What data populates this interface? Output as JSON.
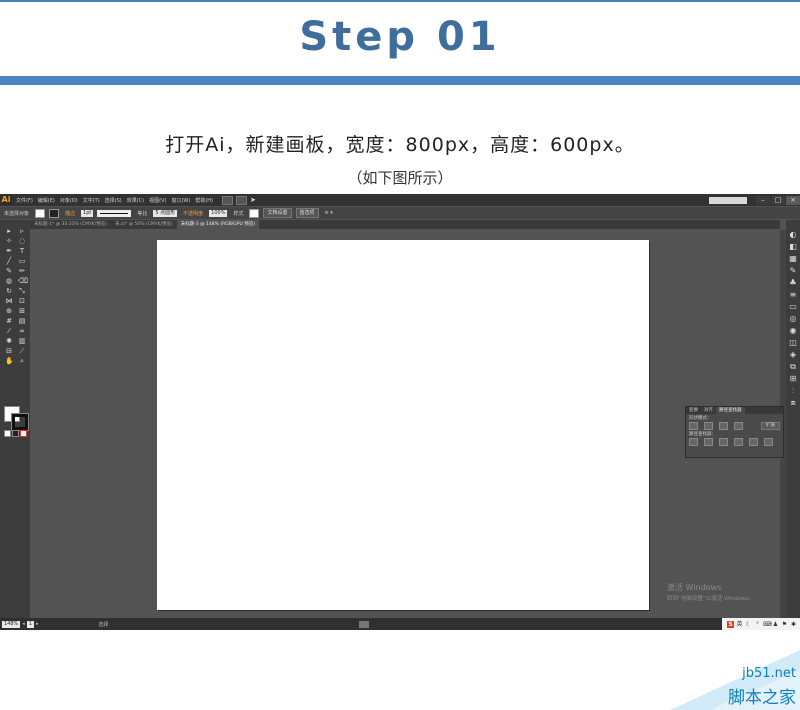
{
  "header": {
    "step_title": "Step 01",
    "instruction": "打开Ai，新建画板，宽度：800px，高度：600px。",
    "subnote": "（如下图所示）"
  },
  "app": {
    "logo": "Ai",
    "menu": [
      "文件(F)",
      "编辑(E)",
      "对象(O)",
      "文字(T)",
      "选择(S)",
      "效果(C)",
      "视图(V)",
      "窗口(W)",
      "帮助(H)"
    ],
    "window_buttons": [
      "–",
      "□",
      "×"
    ],
    "control_bar": {
      "no_selection": "未选择对象",
      "stroke_label": "描边",
      "stroke_value": "1pt",
      "stroke_style": "等比",
      "brush_label": "5 点圆形",
      "opacity_label": "不透明度",
      "opacity_value": "100%",
      "style_label": "样式",
      "doc_setup_btn": "文档设置",
      "prefs_btn": "首选项"
    },
    "tabs": [
      {
        "label": "未标题-1* @ 33.33% (CMYK/预览)",
        "active": false
      },
      {
        "label": "未.ai* @ 50% (CMYK/预览)",
        "active": false
      },
      {
        "label": "未标题-3 @ 148% (RGB/GPU 预览)",
        "active": true
      }
    ],
    "float_panel": {
      "tabs": [
        "变换",
        "对齐",
        "路径查找器"
      ],
      "active_tab": "路径查找器",
      "shape_modes": "形状模式：",
      "expand_btn": "扩展",
      "pathfinders": "路径查找器："
    },
    "status": {
      "zoom": "148%",
      "page": "1",
      "tool": "选择"
    },
    "os_watermark": {
      "title": "激活 Windows",
      "subtitle": "转到“电脑设置”以激活 Windows。"
    }
  },
  "site_watermark": {
    "domain": "jb51.net",
    "name": "脚本之家"
  },
  "colors": {
    "accent_blue": "#4a86c5",
    "title_blue": "#3f6d9c",
    "ai_orange": "#f4a11a",
    "workspace_gray": "#535353"
  }
}
